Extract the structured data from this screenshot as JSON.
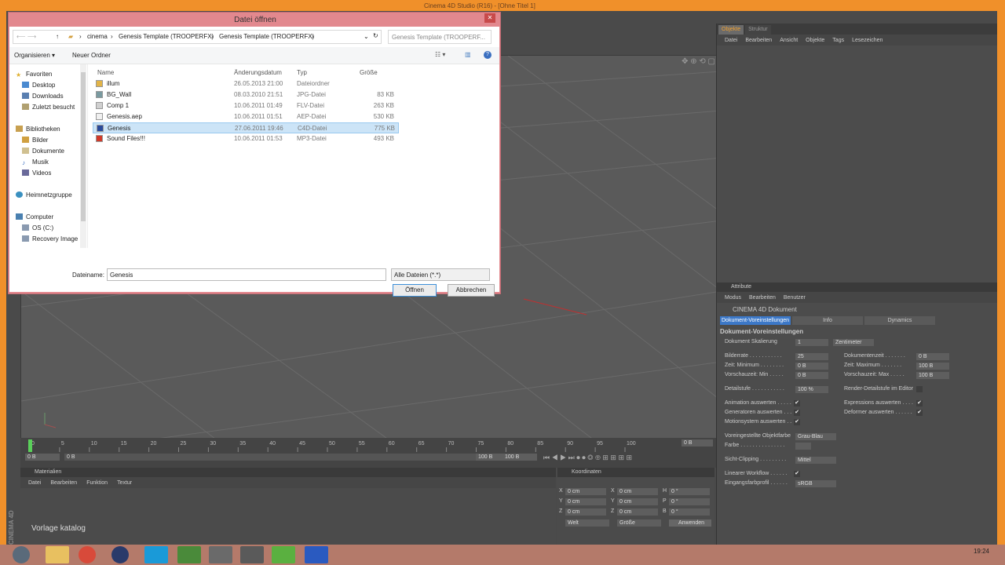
{
  "app": {
    "title": "Cinema 4D Studio (R16) - [Ohne Titel 1]"
  },
  "dialog": {
    "title": "Datei öffnen",
    "breadcrumb": [
      "cinema",
      "Genesis Template (TROOPERFX)",
      "Genesis Template (TROOPERFX)"
    ],
    "search_placeholder": "Genesis Template (TROOPERF...",
    "toolbar": {
      "organize": "Organisieren ▾",
      "new_folder": "Neuer Ordner"
    },
    "nav": {
      "favorites": "Favoriten",
      "favorites_items": [
        "Desktop",
        "Downloads",
        "Zuletzt besucht"
      ],
      "libraries": "Bibliotheken",
      "libraries_items": [
        "Bilder",
        "Dokumente",
        "Musik",
        "Videos"
      ],
      "homegroup": "Heimnetzgruppe",
      "computer": "Computer",
      "computer_items": [
        "OS (C:)",
        "Recovery Image ("
      ]
    },
    "columns": [
      "Name",
      "Änderungsdatum",
      "Typ",
      "Größe"
    ],
    "files": [
      {
        "name": "illum",
        "date": "26.05.2013 21:00",
        "type": "Dateiordner",
        "size": ""
      },
      {
        "name": "BG_Wall",
        "date": "08.03.2010 21:51",
        "type": "JPG-Datei",
        "size": "83 KB"
      },
      {
        "name": "Comp 1",
        "date": "10.06.2011 01:49",
        "type": "FLV-Datei",
        "size": "263 KB"
      },
      {
        "name": "Genesis.aep",
        "date": "10.06.2011 01:51",
        "type": "AEP-Datei",
        "size": "530 KB"
      },
      {
        "name": "Genesis",
        "date": "27.06.2011 19:46",
        "type": "C4D-Datei",
        "size": "775 KB"
      },
      {
        "name": "Sound Files!!!",
        "date": "10.06.2011 01:53",
        "type": "MP3-Datei",
        "size": "493 KB"
      }
    ],
    "selected_index": 4,
    "filename_label": "Dateiname:",
    "filename_value": "Genesis",
    "filetype_value": "Alle Dateien (*.*)",
    "open_button": "Öffnen",
    "cancel_button": "Abbrechen"
  },
  "objects_panel": {
    "tabs": [
      "Objekte",
      "Struktur"
    ],
    "menu": [
      "Datei",
      "Bearbeiten",
      "Ansicht",
      "Objekte",
      "Tags",
      "Lesezeichen"
    ]
  },
  "attributes_panel": {
    "title": "Attribute",
    "menu": [
      "Modus",
      "Bearbeiten",
      "Benutzer"
    ],
    "object": "CINEMA 4D Dokument",
    "tabs": [
      "Dokument-Voreinstellungen",
      "Info",
      "Dynamics"
    ],
    "section": "Dokument-Voreinstellungen",
    "scale_label": "Dokument Skalierung",
    "scale_value": "1",
    "scale_unit": "Zentimeter",
    "fps_label": "Bilderrate . . . . . . . . . . .",
    "fps_value": "25",
    "doctime_label": "Dokumentenzeit . . . . . . .",
    "doctime_value": "0 B",
    "mintime_label": "Zeit: Minimum . . . . . . . .",
    "mintime_value": "0 B",
    "maxtime_label": "Zeit: Maximum . . . . . . .",
    "maxtime_value": "100 B",
    "prevmin_label": "Vorschauzeit: Min . . . . .",
    "prevmin_value": "0 B",
    "prevmax_label": "Vorschauzeit: Max . . . . .",
    "prevmax_value": "100 B",
    "lod_label": "Detailstufe . . . . . . . . . . .",
    "lod_value": "100 %",
    "renderlod_label": "Render-Detailstufe im Editor",
    "anim_label": "Animation auswerten . . . . .",
    "expr_label": "Expressions auswerten . . . .",
    "gen_label": "Generatoren auswerten . . .",
    "deform_label": "Deformer auswerten . . . . . .",
    "motion_label": "Motionsystem auswerten . .",
    "objcolor_label": "Voreingestellte Objektfarbe",
    "objcolor_value": "Grau-Blau",
    "color_label": "Farbe . . . . . . . . . . . . . . .",
    "clip_label": "Sicht-Clipping . . . . . . . . .",
    "clip_value": "Mittel",
    "linear_label": "Linearer Workflow . . . . . .",
    "profile_label": "Eingangsfarbprofil . . . . . .",
    "profile_value": "sRGB",
    "checkmark": "✔"
  },
  "timeline": {
    "ticks": [
      "0",
      "5",
      "10",
      "15",
      "20",
      "25",
      "30",
      "35",
      "40",
      "45",
      "50",
      "55",
      "60",
      "65",
      "70",
      "75",
      "80",
      "85",
      "90",
      "95",
      "100"
    ],
    "frame_display": "0 B",
    "start_field": "0 B",
    "end_field": "100 B",
    "end_field2": "100 B",
    "cur_field": "0 B"
  },
  "materials": {
    "title": "Materialien",
    "menu": [
      "Datei",
      "Bearbeiten",
      "Funktion",
      "Textur"
    ]
  },
  "coordinates": {
    "title": "Koordinaten",
    "rows": [
      {
        "a": "X",
        "av": "0 cm",
        "b": "X",
        "bv": "0 cm",
        "c": "H",
        "cv": "0 °"
      },
      {
        "a": "Y",
        "av": "0 cm",
        "b": "Y",
        "bv": "0 cm",
        "c": "P",
        "cv": "0 °"
      },
      {
        "a": "Z",
        "av": "0 cm",
        "b": "Z",
        "bv": "0 cm",
        "c": "B",
        "cv": "0 °"
      }
    ],
    "mode1": "Welt",
    "mode2": "Größe",
    "apply": "Anwenden"
  },
  "c4d_logo": "CINEMA 4D",
  "bottom_text": "Vorlage katalog",
  "taskbar": {
    "time": "19:24"
  },
  "colors": {
    "accent": "#f0902a",
    "selection": "#3c78c8",
    "dialog_frame": "#e2888e"
  }
}
